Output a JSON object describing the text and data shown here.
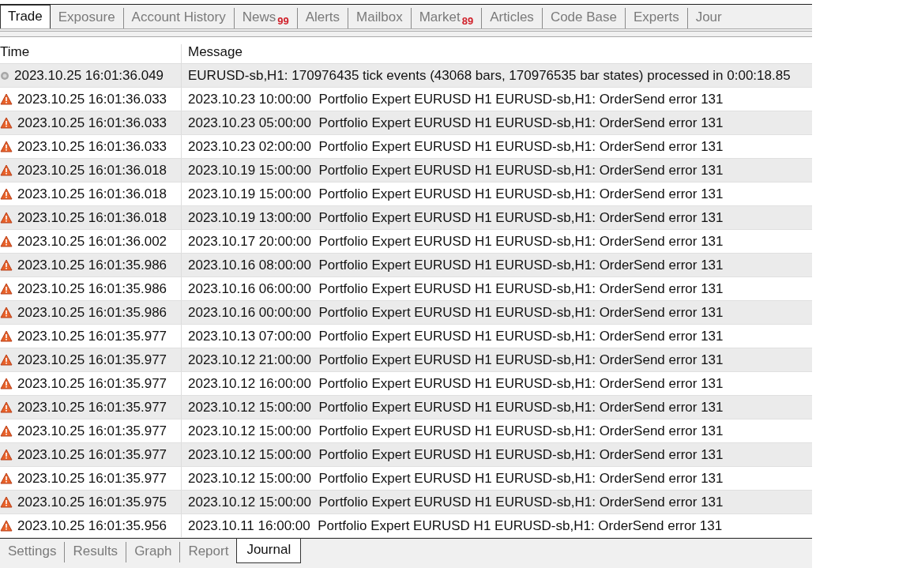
{
  "top_tabs": [
    {
      "label": "Trade",
      "selected": true
    },
    {
      "label": "Exposure",
      "selected": false
    },
    {
      "label": "Account History",
      "selected": false
    },
    {
      "label": "News",
      "badge": "99",
      "selected": false
    },
    {
      "label": "Alerts",
      "selected": false
    },
    {
      "label": "Mailbox",
      "selected": false
    },
    {
      "label": "Market",
      "badge": "89",
      "selected": false
    },
    {
      "label": "Articles",
      "selected": false
    },
    {
      "label": "Code Base",
      "selected": false
    },
    {
      "label": "Experts",
      "selected": false
    },
    {
      "label": "Jour",
      "selected": false
    }
  ],
  "journal": {
    "columns": [
      "Time",
      "Message"
    ],
    "rows": [
      {
        "kind": "info",
        "time": "2023.10.25 16:01:36.049",
        "message": "EURUSD-sb,H1: 170976435 tick events (43068 bars, 170976535 bar states) processed in 0:00:18.85"
      },
      {
        "kind": "warning",
        "time": "2023.10.25 16:01:36.033",
        "message": "2023.10.23 10:00:00  Portfolio Expert EURUSD H1 EURUSD-sb,H1: OrderSend error 131"
      },
      {
        "kind": "warning",
        "time": "2023.10.25 16:01:36.033",
        "message": "2023.10.23 05:00:00  Portfolio Expert EURUSD H1 EURUSD-sb,H1: OrderSend error 131"
      },
      {
        "kind": "warning",
        "time": "2023.10.25 16:01:36.033",
        "message": "2023.10.23 02:00:00  Portfolio Expert EURUSD H1 EURUSD-sb,H1: OrderSend error 131"
      },
      {
        "kind": "warning",
        "time": "2023.10.25 16:01:36.018",
        "message": "2023.10.19 15:00:00  Portfolio Expert EURUSD H1 EURUSD-sb,H1: OrderSend error 131"
      },
      {
        "kind": "warning",
        "time": "2023.10.25 16:01:36.018",
        "message": "2023.10.19 15:00:00  Portfolio Expert EURUSD H1 EURUSD-sb,H1: OrderSend error 131"
      },
      {
        "kind": "warning",
        "time": "2023.10.25 16:01:36.018",
        "message": "2023.10.19 13:00:00  Portfolio Expert EURUSD H1 EURUSD-sb,H1: OrderSend error 131"
      },
      {
        "kind": "warning",
        "time": "2023.10.25 16:01:36.002",
        "message": "2023.10.17 20:00:00  Portfolio Expert EURUSD H1 EURUSD-sb,H1: OrderSend error 131"
      },
      {
        "kind": "warning",
        "time": "2023.10.25 16:01:35.986",
        "message": "2023.10.16 08:00:00  Portfolio Expert EURUSD H1 EURUSD-sb,H1: OrderSend error 131"
      },
      {
        "kind": "warning",
        "time": "2023.10.25 16:01:35.986",
        "message": "2023.10.16 06:00:00  Portfolio Expert EURUSD H1 EURUSD-sb,H1: OrderSend error 131"
      },
      {
        "kind": "warning",
        "time": "2023.10.25 16:01:35.986",
        "message": "2023.10.16 00:00:00  Portfolio Expert EURUSD H1 EURUSD-sb,H1: OrderSend error 131"
      },
      {
        "kind": "warning",
        "time": "2023.10.25 16:01:35.977",
        "message": "2023.10.13 07:00:00  Portfolio Expert EURUSD H1 EURUSD-sb,H1: OrderSend error 131"
      },
      {
        "kind": "warning",
        "time": "2023.10.25 16:01:35.977",
        "message": "2023.10.12 21:00:00  Portfolio Expert EURUSD H1 EURUSD-sb,H1: OrderSend error 131"
      },
      {
        "kind": "warning",
        "time": "2023.10.25 16:01:35.977",
        "message": "2023.10.12 16:00:00  Portfolio Expert EURUSD H1 EURUSD-sb,H1: OrderSend error 131"
      },
      {
        "kind": "warning",
        "time": "2023.10.25 16:01:35.977",
        "message": "2023.10.12 15:00:00  Portfolio Expert EURUSD H1 EURUSD-sb,H1: OrderSend error 131"
      },
      {
        "kind": "warning",
        "time": "2023.10.25 16:01:35.977",
        "message": "2023.10.12 15:00:00  Portfolio Expert EURUSD H1 EURUSD-sb,H1: OrderSend error 131"
      },
      {
        "kind": "warning",
        "time": "2023.10.25 16:01:35.977",
        "message": "2023.10.12 15:00:00  Portfolio Expert EURUSD H1 EURUSD-sb,H1: OrderSend error 131"
      },
      {
        "kind": "warning",
        "time": "2023.10.25 16:01:35.977",
        "message": "2023.10.12 15:00:00  Portfolio Expert EURUSD H1 EURUSD-sb,H1: OrderSend error 131"
      },
      {
        "kind": "warning",
        "time": "2023.10.25 16:01:35.975",
        "message": "2023.10.12 15:00:00  Portfolio Expert EURUSD H1 EURUSD-sb,H1: OrderSend error 131"
      },
      {
        "kind": "warning",
        "time": "2023.10.25 16:01:35.956",
        "message": "2023.10.11 16:00:00  Portfolio Expert EURUSD H1 EURUSD-sb,H1: OrderSend error 131"
      }
    ]
  },
  "bottom_tabs": [
    {
      "label": "Settings",
      "selected": false
    },
    {
      "label": "Results",
      "selected": false
    },
    {
      "label": "Graph",
      "selected": false
    },
    {
      "label": "Report",
      "selected": false
    },
    {
      "label": "Journal",
      "selected": true
    }
  ]
}
